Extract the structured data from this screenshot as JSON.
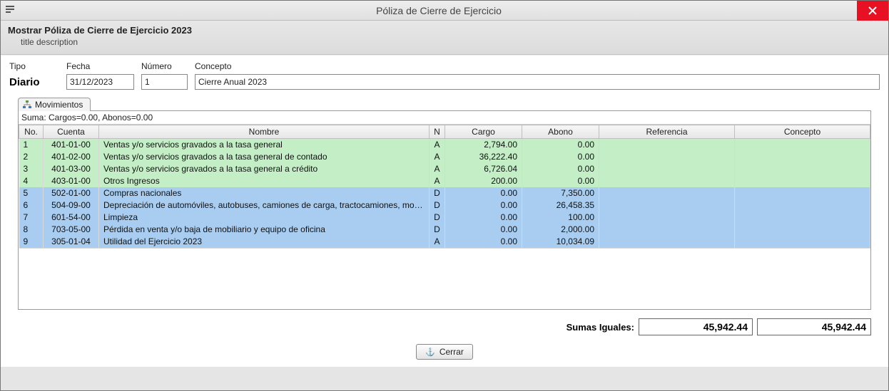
{
  "window": {
    "title": "Póliza de Cierre de Ejercicio"
  },
  "header": {
    "title": "Mostrar Póliza de Cierre de Ejercicio 2023",
    "subtitle": "title description"
  },
  "form": {
    "tipo_label": "Tipo",
    "fecha_label": "Fecha",
    "numero_label": "Número",
    "concepto_label": "Concepto",
    "tipo_value": "Diario",
    "fecha_value": "31/12/2023",
    "numero_value": "1",
    "concepto_value": "Cierre Anual 2023"
  },
  "tab": {
    "label": "Movimientos"
  },
  "grid": {
    "suma_line": "Suma:  Cargos=0.00, Abonos=0.00",
    "columns": {
      "no": "No.",
      "cuenta": "Cuenta",
      "nombre": "Nombre",
      "n": "N",
      "cargo": "Cargo",
      "abono": "Abono",
      "referencia": "Referencia",
      "concepto": "Concepto"
    },
    "rows": [
      {
        "no": "1",
        "cuenta": "401-01-00",
        "nombre": "Ventas y/o servicios gravados a la tasa general",
        "n": "A",
        "cargo": "2,794.00",
        "abono": "0.00",
        "ref": "",
        "concep": "",
        "color": "green"
      },
      {
        "no": "2",
        "cuenta": "401-02-00",
        "nombre": "Ventas y/o servicios gravados a la tasa general de contado",
        "n": "A",
        "cargo": "36,222.40",
        "abono": "0.00",
        "ref": "",
        "concep": "",
        "color": "green"
      },
      {
        "no": "3",
        "cuenta": "401-03-00",
        "nombre": "Ventas y/o servicios gravados a la tasa general a crédito",
        "n": "A",
        "cargo": "6,726.04",
        "abono": "0.00",
        "ref": "",
        "concep": "",
        "color": "green"
      },
      {
        "no": "4",
        "cuenta": "403-01-00",
        "nombre": "Otros Ingresos",
        "n": "A",
        "cargo": "200.00",
        "abono": "0.00",
        "ref": "",
        "concep": "",
        "color": "green"
      },
      {
        "no": "5",
        "cuenta": "502-01-00",
        "nombre": "Compras nacionales",
        "n": "D",
        "cargo": "0.00",
        "abono": "7,350.00",
        "ref": "",
        "concep": "",
        "color": "blue"
      },
      {
        "no": "6",
        "cuenta": "504-09-00",
        "nombre": "Depreciación de automóviles, autobuses, camiones de carga, tractocamiones, montacarg...",
        "n": "D",
        "cargo": "0.00",
        "abono": "26,458.35",
        "ref": "",
        "concep": "",
        "color": "blue"
      },
      {
        "no": "7",
        "cuenta": "601-54-00",
        "nombre": "Limpieza",
        "n": "D",
        "cargo": "0.00",
        "abono": "100.00",
        "ref": "",
        "concep": "",
        "color": "blue"
      },
      {
        "no": "8",
        "cuenta": "703-05-00",
        "nombre": "Pérdida en venta y/o baja de mobiliario y equipo de oficina",
        "n": "D",
        "cargo": "0.00",
        "abono": "2,000.00",
        "ref": "",
        "concep": "",
        "color": "blue"
      },
      {
        "no": "9",
        "cuenta": "305-01-04",
        "nombre": "Utilidad del Ejercicio 2023",
        "n": "A",
        "cargo": "0.00",
        "abono": "10,034.09",
        "ref": "",
        "concep": "",
        "color": "blue"
      }
    ]
  },
  "totals": {
    "label": "Sumas Iguales:",
    "cargo_total": "45,942.44",
    "abono_total": "45,942.44"
  },
  "footer": {
    "close_label": "Cerrar"
  }
}
